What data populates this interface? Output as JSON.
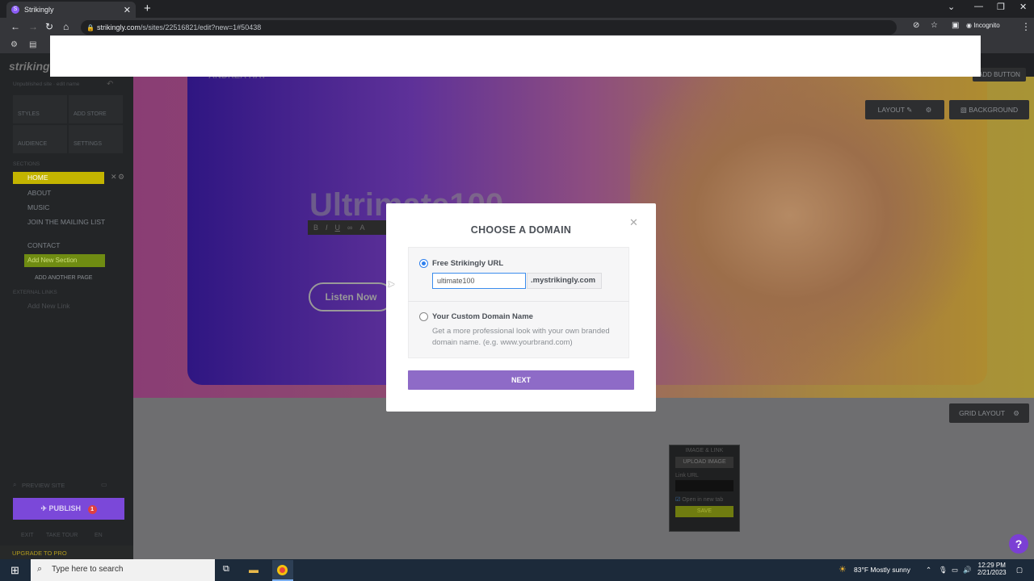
{
  "browser": {
    "tab_title": "Strikingly",
    "tab_favicon": "S",
    "url_host": "strikingly.com",
    "url_path": "/s/sites/22516821/edit?new=1#50438",
    "profile": "Incognito"
  },
  "sidebar": {
    "logo": "strikingly",
    "subtitle": "Unpublished site · edit name",
    "buttons": [
      "STYLES",
      "ADD STORE",
      "AUDIENCE",
      "SETTINGS"
    ],
    "sections_label": "SECTIONS",
    "items": [
      "HOME",
      "ABOUT",
      "MUSIC",
      "JOIN THE MAILING LIST",
      "CONTACT"
    ],
    "add_section": "Add New Section",
    "add_page": "ADD ANOTHER PAGE",
    "external_label": "EXTERNAL LINKS",
    "add_link": "Add New Link",
    "preview": "PREVIEW SITE",
    "publish": "PUBLISH",
    "publish_badge": "1",
    "footer": [
      "EXIT",
      "TAKE TOUR",
      "EN"
    ],
    "upgrade": "UPGRADE TO PRO"
  },
  "canvas": {
    "site_name": "ANDREA HAY",
    "add_button": "ADD BUTTON",
    "layout": "LAYOUT",
    "background": "BACKGROUND",
    "hero_title": "Ultrimate100",
    "listen_button": "Listen Now",
    "grid_layout": "GRID LAYOUT",
    "image_panel": {
      "title": "IMAGE & LINK",
      "upload": "UPLOAD IMAGE",
      "link_label": "Link URL",
      "new_tab": "Open in new tab",
      "save": "SAVE"
    }
  },
  "modal": {
    "title": "CHOOSE A DOMAIN",
    "option1_label": "Free Strikingly URL",
    "subdomain_value": "ultimate100",
    "suffix": ".mystrikingly.com",
    "option2_label": "Your Custom Domain Name",
    "option2_desc": "Get a more professional look with your own branded domain name. (e.g. www.yourbrand.com)",
    "next": "NEXT"
  },
  "taskbar": {
    "search_placeholder": "Type here to search",
    "weather": "83°F  Mostly sunny",
    "time": "12:29 PM",
    "date": "2/21/2023"
  },
  "colors": {
    "accent": "#8e6bc7",
    "publish": "#7b48d9",
    "home_highlight": "#c3b400",
    "input_focus": "#3b8ded"
  }
}
